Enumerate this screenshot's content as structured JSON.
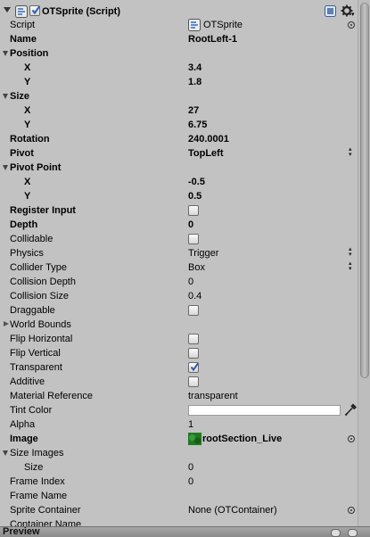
{
  "component": {
    "title": "OTSprite (Script)",
    "enabled": true
  },
  "rows": [
    {
      "label": "Script",
      "bold": false,
      "indent": 0,
      "fold": "",
      "value": "OTSprite",
      "control": "object",
      "icon": "script-icon"
    },
    {
      "label": "Name",
      "bold": true,
      "indent": 0,
      "fold": "",
      "value": "RootLeft-1",
      "control": "text"
    },
    {
      "label": "Position",
      "bold": true,
      "indent": 0,
      "fold": "open",
      "value": "",
      "control": "none"
    },
    {
      "label": "X",
      "bold": true,
      "indent": 1,
      "fold": "",
      "value": "3.4",
      "control": "text"
    },
    {
      "label": "Y",
      "bold": true,
      "indent": 1,
      "fold": "",
      "value": "1.8",
      "control": "text"
    },
    {
      "label": "Size",
      "bold": true,
      "indent": 0,
      "fold": "open",
      "value": "",
      "control": "none"
    },
    {
      "label": "X",
      "bold": true,
      "indent": 1,
      "fold": "",
      "value": "27",
      "control": "text"
    },
    {
      "label": "Y",
      "bold": true,
      "indent": 1,
      "fold": "",
      "value": "6.75",
      "control": "text"
    },
    {
      "label": "Rotation",
      "bold": true,
      "indent": 0,
      "fold": "",
      "value": "240.0001",
      "control": "text"
    },
    {
      "label": "Pivot",
      "bold": true,
      "indent": 0,
      "fold": "",
      "value": "TopLeft",
      "control": "popup"
    },
    {
      "label": "Pivot Point",
      "bold": true,
      "indent": 0,
      "fold": "open",
      "value": "",
      "control": "none"
    },
    {
      "label": "X",
      "bold": true,
      "indent": 1,
      "fold": "",
      "value": "-0.5",
      "control": "text"
    },
    {
      "label": "Y",
      "bold": true,
      "indent": 1,
      "fold": "",
      "value": "0.5",
      "control": "text"
    },
    {
      "label": "Register Input",
      "bold": true,
      "indent": 0,
      "fold": "",
      "value": "",
      "control": "checkbox",
      "checked": false
    },
    {
      "label": "Depth",
      "bold": true,
      "indent": 0,
      "fold": "",
      "value": "0",
      "control": "text"
    },
    {
      "label": "Collidable",
      "bold": false,
      "indent": 0,
      "fold": "",
      "value": "",
      "control": "checkbox",
      "checked": false
    },
    {
      "label": "Physics",
      "bold": false,
      "indent": 0,
      "fold": "",
      "value": "Trigger",
      "control": "popup"
    },
    {
      "label": "Collider Type",
      "bold": false,
      "indent": 0,
      "fold": "",
      "value": "Box",
      "control": "popup"
    },
    {
      "label": "Collision Depth",
      "bold": false,
      "indent": 0,
      "fold": "",
      "value": "0",
      "control": "text"
    },
    {
      "label": "Collision Size",
      "bold": false,
      "indent": 0,
      "fold": "",
      "value": "0.4",
      "control": "text"
    },
    {
      "label": "Draggable",
      "bold": false,
      "indent": 0,
      "fold": "",
      "value": "",
      "control": "checkbox",
      "checked": false
    },
    {
      "label": "World Bounds",
      "bold": false,
      "indent": 0,
      "fold": "closed",
      "value": "",
      "control": "none"
    },
    {
      "label": "Flip Horizontal",
      "bold": false,
      "indent": 0,
      "fold": "",
      "value": "",
      "control": "checkbox",
      "checked": false
    },
    {
      "label": "Flip Vertical",
      "bold": false,
      "indent": 0,
      "fold": "",
      "value": "",
      "control": "checkbox",
      "checked": false
    },
    {
      "label": "Transparent",
      "bold": false,
      "indent": 0,
      "fold": "",
      "value": "",
      "control": "checkbox",
      "checked": true
    },
    {
      "label": "Additive",
      "bold": false,
      "indent": 0,
      "fold": "",
      "value": "",
      "control": "checkbox",
      "checked": false
    },
    {
      "label": "Material Reference",
      "bold": false,
      "indent": 0,
      "fold": "",
      "value": "transparent",
      "control": "text"
    },
    {
      "label": "Tint Color",
      "bold": false,
      "indent": 0,
      "fold": "",
      "value": "",
      "control": "color",
      "color": "#ffffff"
    },
    {
      "label": "Alpha",
      "bold": false,
      "indent": 0,
      "fold": "",
      "value": "1",
      "control": "text"
    },
    {
      "label": "Image",
      "bold": true,
      "indent": 0,
      "fold": "",
      "value": "rootSection_Live",
      "control": "object",
      "icon": "texture-thumbnail"
    },
    {
      "label": "Size Images",
      "bold": false,
      "indent": 0,
      "fold": "open",
      "value": "",
      "control": "none"
    },
    {
      "label": "Size",
      "bold": false,
      "indent": 1,
      "fold": "",
      "value": "0",
      "control": "text"
    },
    {
      "label": "Frame Index",
      "bold": false,
      "indent": 0,
      "fold": "",
      "value": "0",
      "control": "text"
    },
    {
      "label": "Frame Name",
      "bold": false,
      "indent": 0,
      "fold": "",
      "value": "",
      "control": "text"
    },
    {
      "label": "Sprite Container",
      "bold": false,
      "indent": 0,
      "fold": "",
      "value": "None (OTContainer)",
      "control": "object"
    },
    {
      "label": "Container Name",
      "bold": false,
      "indent": 0,
      "fold": "",
      "value": "",
      "control": "text"
    }
  ],
  "preview": {
    "label": "Preview"
  },
  "colors": {
    "panel_bg": "#c2c2c2",
    "checkbox_tick": "#2a5db0",
    "texture_green": "#1f7a1f"
  },
  "icons": [
    "component-script-icon",
    "help-icon",
    "gear-icon",
    "eyedropper-icon",
    "object-picker-icon"
  ]
}
